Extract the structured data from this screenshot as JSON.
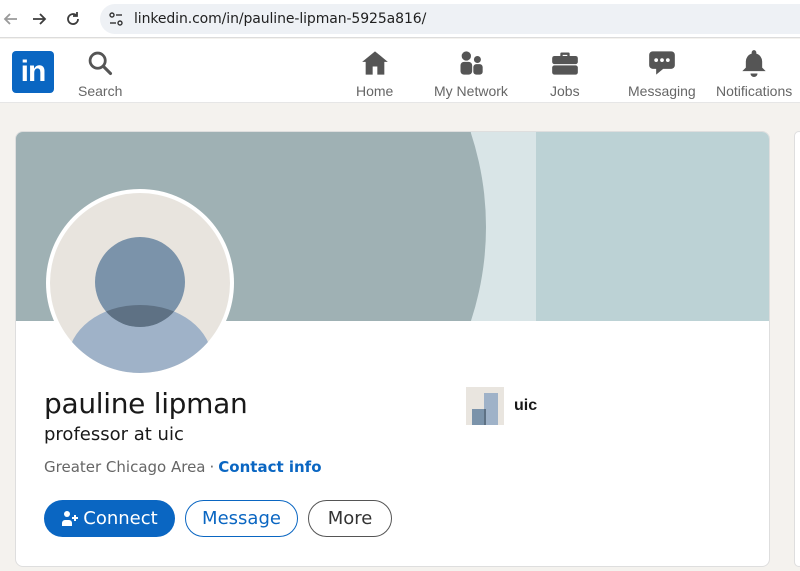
{
  "browser": {
    "url": "linkedin.com/in/pauline-lipman-5925a816/"
  },
  "header": {
    "logo": "in",
    "nav": {
      "search": "Search",
      "home": "Home",
      "network": "My Network",
      "jobs": "Jobs",
      "messaging": "Messaging",
      "notifications": "Notifications"
    }
  },
  "profile": {
    "name": "pauline lipman",
    "headline": "professor at uic",
    "location": "Greater Chicago Area",
    "separator": "·",
    "contact_info": "Contact info",
    "company": "uic",
    "actions": {
      "connect": "Connect",
      "message": "Message",
      "more": "More"
    }
  },
  "colors": {
    "brand": "#0a66c2",
    "banner": "#bcd2d5",
    "banner_arc": "#9fb1b4"
  }
}
